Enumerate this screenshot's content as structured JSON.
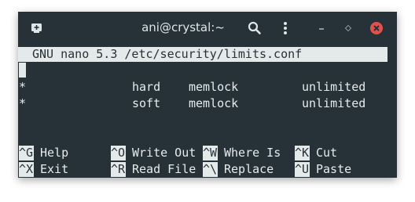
{
  "window": {
    "title": "ani@crystal:~",
    "new_tab_icon": "new-tab-icon",
    "search_icon": "search-icon",
    "menu_icon": "kebab-menu-icon",
    "minimize_icon": "minimize-icon",
    "maximize_icon": "maximize-icon",
    "close_icon": "close-icon",
    "close_color": "#e2504e"
  },
  "nano": {
    "header": "GNU nano 5.3 /etc/security/limits.conf",
    "lines": [
      {
        "domain": "*",
        "type": "hard",
        "item": "memlock",
        "value": "unlimited"
      },
      {
        "domain": "*",
        "type": "soft",
        "item": "memlock",
        "value": "unlimited"
      }
    ],
    "shortcuts_row1": [
      {
        "key": "^G",
        "label": "Help"
      },
      {
        "key": "^O",
        "label": "Write Out"
      },
      {
        "key": "^W",
        "label": "Where Is"
      },
      {
        "key": "^K",
        "label": "Cut"
      }
    ],
    "shortcuts_row2": [
      {
        "key": "^X",
        "label": "Exit"
      },
      {
        "key": "^R",
        "label": "Read File"
      },
      {
        "key": "^\\",
        "label": "Replace"
      },
      {
        "key": "^U",
        "label": "Paste"
      }
    ]
  },
  "colors": {
    "background": "#263238",
    "foreground": "#e6ecee",
    "highlight": "#e4e9ea"
  }
}
